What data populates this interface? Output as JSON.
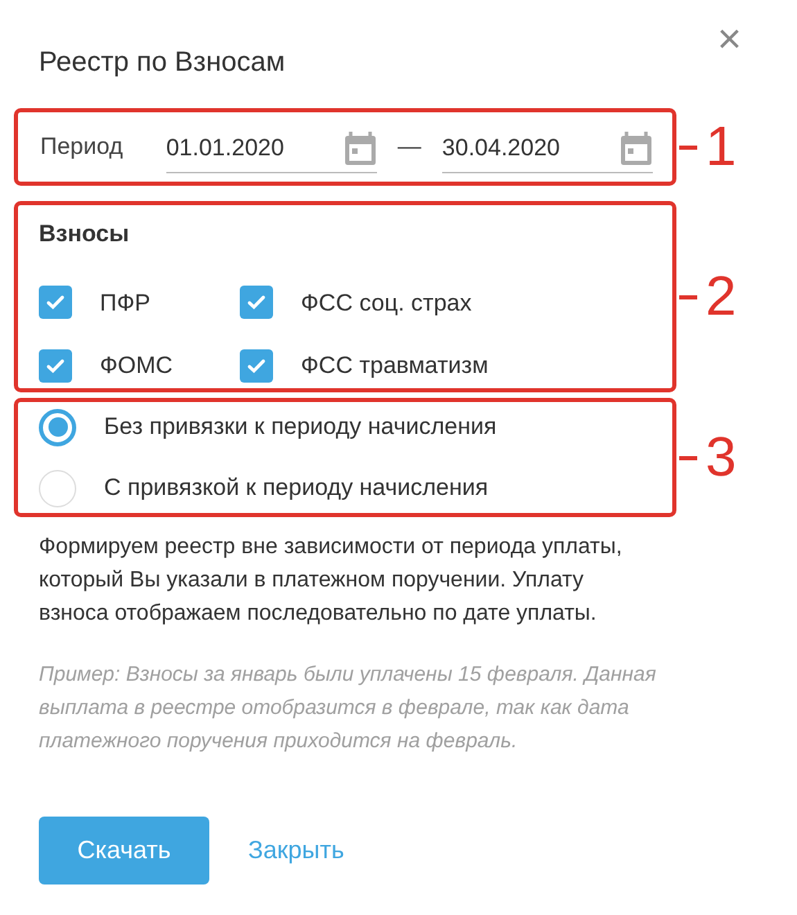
{
  "dialog": {
    "title": "Реестр по Взносам",
    "close": "×"
  },
  "period": {
    "callout": "1",
    "label": "Период",
    "from": "01.01.2020",
    "separator": "—",
    "to": "30.04.2020"
  },
  "contributions": {
    "callout": "2",
    "heading": "Взносы",
    "items": [
      {
        "label": "ПФР",
        "checked": true
      },
      {
        "label": "ФСС соц. страх",
        "checked": true
      },
      {
        "label": "ФОМС",
        "checked": true
      },
      {
        "label": "ФСС травматизм",
        "checked": true
      }
    ]
  },
  "binding": {
    "callout": "3",
    "options": [
      {
        "label": "Без привязки к периоду начисления",
        "selected": true
      },
      {
        "label": "С привязкой к периоду начисления",
        "selected": false
      }
    ]
  },
  "description": "Формируем реестр вне зависимости от периода уплаты, который Вы указали в платежном поручении. Уплату взноса отображаем последовательно по дате уплаты.",
  "example": "Пример: Взносы за январь были уплачены 15 февраля. Данная выплата в реестре отобразится в феврале, так как дата платежного поручения приходится на февраль.",
  "buttons": {
    "primary": "Скачать",
    "secondary": "Закрыть"
  }
}
